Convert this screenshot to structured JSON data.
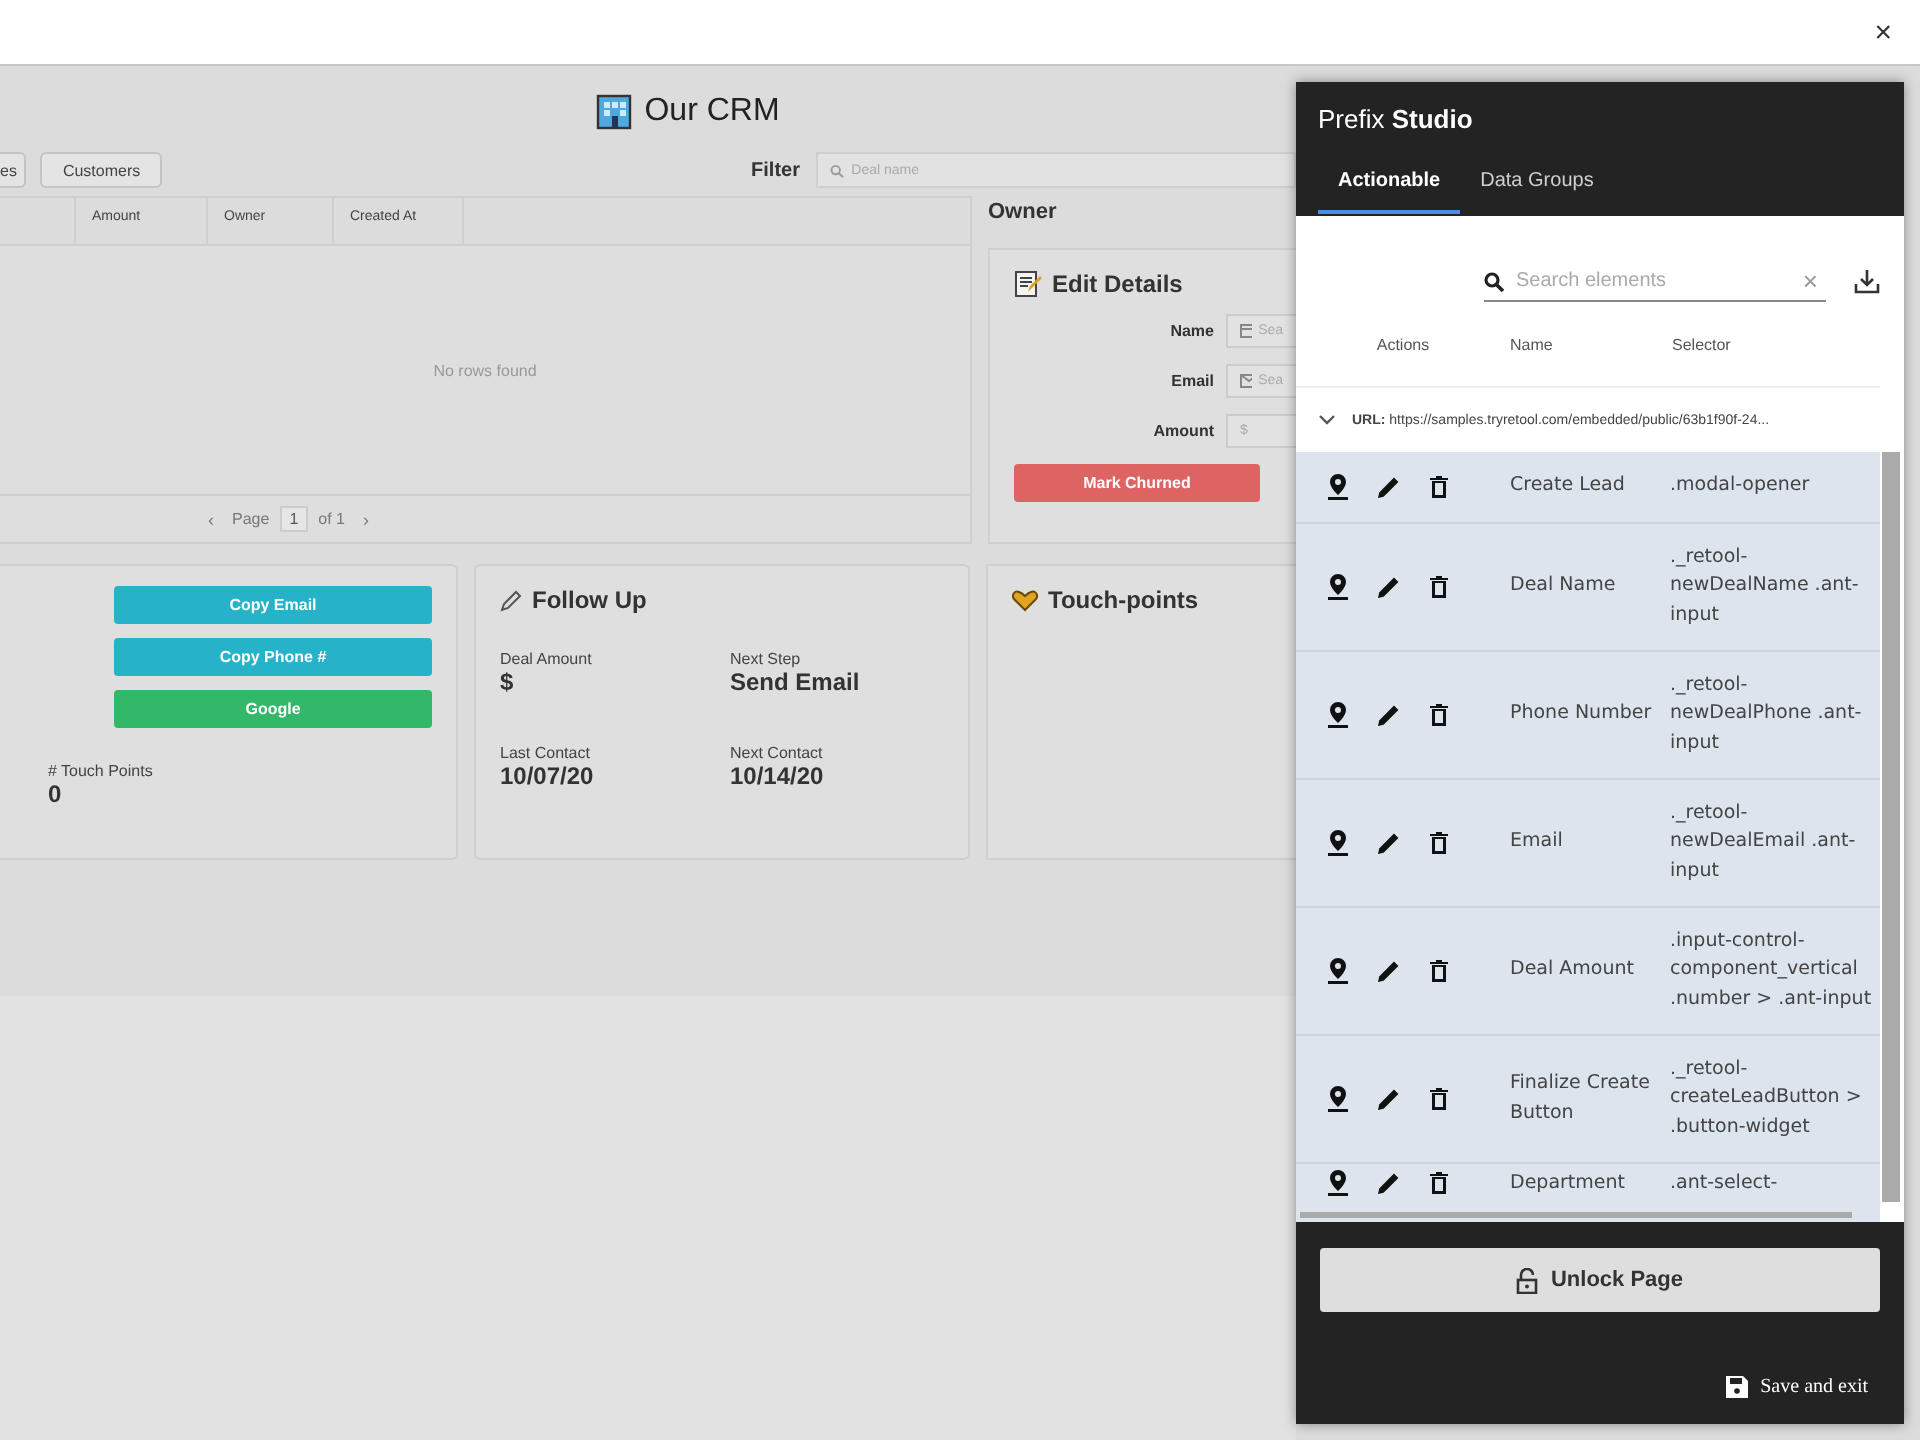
{
  "browser_bar": {
    "close": "×"
  },
  "app": {
    "title": "Our CRM",
    "nav_buttons": [
      "es",
      "Customers"
    ],
    "filter": {
      "label": "Filter",
      "placeholder": "Deal name"
    },
    "table": {
      "columns": [
        "",
        "Amount",
        "Owner",
        "Created At"
      ],
      "empty_text": "No rows found",
      "pager": {
        "prev": "‹",
        "label": "Page",
        "page": "1",
        "of": "of 1",
        "next": "›"
      }
    },
    "owner_label": "Owner",
    "edit_details": {
      "title": "Edit Details",
      "fields": [
        {
          "label": "Name",
          "kind": "card",
          "placeholder": "Sea"
        },
        {
          "label": "Email",
          "kind": "mail",
          "placeholder": "Sea"
        },
        {
          "label": "Amount",
          "kind": "money",
          "placeholder": "$"
        }
      ],
      "button": "Mark Churned"
    },
    "contact_card": {
      "buttons": [
        {
          "label": "Copy Email",
          "kind": "info"
        },
        {
          "label": "Copy Phone #",
          "kind": "info"
        },
        {
          "label": "Google",
          "kind": "success"
        }
      ],
      "stat": {
        "label": "# Touch Points",
        "value": "0"
      }
    },
    "follow_up": {
      "title": "Follow Up",
      "stats": [
        {
          "label": "Deal Amount",
          "value": "$"
        },
        {
          "label": "Next Step",
          "value": "Send Email"
        },
        {
          "label": "Last Contact",
          "value": "10/07/20"
        },
        {
          "label": "Next Contact",
          "value": "10/14/20"
        }
      ]
    },
    "touch_points": {
      "title": "Touch-points"
    }
  },
  "studio": {
    "title_plain": "Prefix",
    "title_bold": "Studio",
    "tabs": [
      {
        "label": "Actionable",
        "selected": true
      },
      {
        "label": "Data Groups",
        "selected": false
      }
    ],
    "search": {
      "placeholder": "Search elements",
      "clear": "×"
    },
    "columns": [
      "Actions",
      "Name",
      "Selector"
    ],
    "url_group": {
      "label": "URL:",
      "value": "https://samples.tryretool.com/embedded/public/63b1f90f-24...",
      "expanded": true
    },
    "rows": [
      {
        "name": "Create Lead",
        "selector": ".modal-opener"
      },
      {
        "name": "Deal Name",
        "selector": "._retool-newDealName .ant-input"
      },
      {
        "name": "Phone Number",
        "selector": "._retool-newDealPhone .ant-input"
      },
      {
        "name": "Email",
        "selector": "._retool-newDealEmail .ant-input"
      },
      {
        "name": "Deal Amount",
        "selector": ".input-control-component_vertical .number > .ant-input"
      },
      {
        "name": "Finalize Create Button",
        "selector": "._retool-createLeadButton > .button-widget"
      },
      {
        "name": "Department",
        "selector": ".ant-select-"
      }
    ],
    "unlock_button": "Unlock Page",
    "save_button": "Save and exit"
  }
}
